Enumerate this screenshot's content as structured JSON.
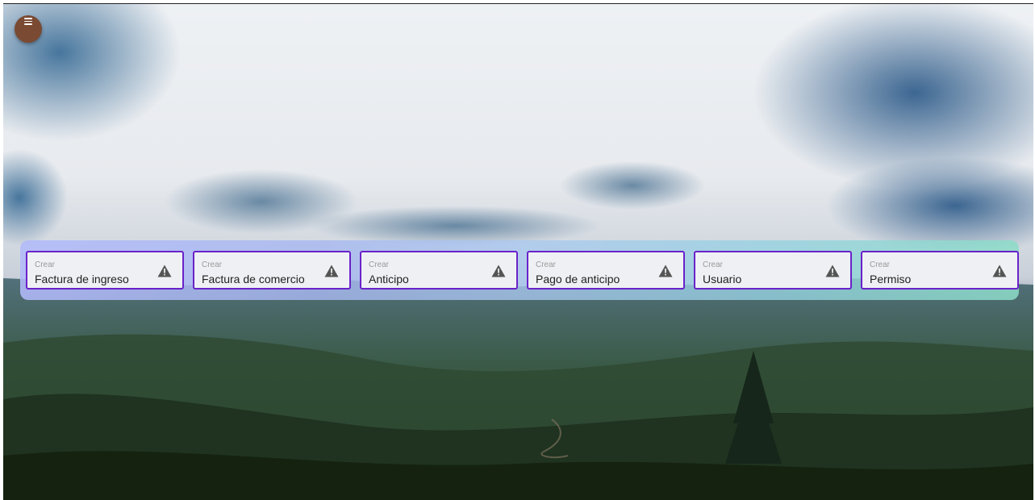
{
  "menu": {
    "icon": "menu-icon",
    "color": "#7a4a32"
  },
  "cards": [
    {
      "caption": "Crear",
      "title": "Factura de ingreso",
      "icon": "warning-icon"
    },
    {
      "caption": "Crear",
      "title": "Factura de comercio",
      "icon": "warning-icon"
    },
    {
      "caption": "Crear",
      "title": "Anticipo",
      "icon": "warning-icon"
    },
    {
      "caption": "Crear",
      "title": "Pago de anticipo",
      "icon": "warning-icon"
    },
    {
      "caption": "Crear",
      "title": "Usuario",
      "icon": "warning-icon"
    },
    {
      "caption": "Crear",
      "title": "Permiso",
      "icon": "warning-icon"
    }
  ],
  "colors": {
    "card_border": "#6a22c9",
    "card_background": "#eef0f3",
    "warning_icon": "#555555"
  }
}
